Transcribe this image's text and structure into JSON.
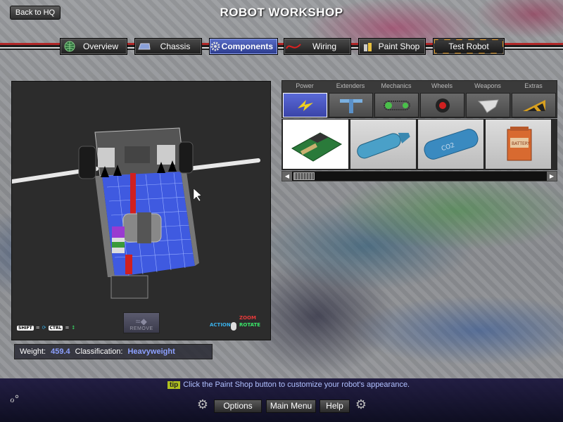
{
  "header": {
    "title": "ROBOT WORKSHOP",
    "back_label": "Back to HQ"
  },
  "tabs": [
    {
      "label": "Overview",
      "icon": "globe-icon"
    },
    {
      "label": "Chassis",
      "icon": "chassis-icon"
    },
    {
      "label": "Components",
      "icon": "gear-icon",
      "active": true
    },
    {
      "label": "Wiring",
      "icon": "wire-icon"
    },
    {
      "label": "Paint Shop",
      "icon": "paint-icon"
    },
    {
      "label": "Test Robot",
      "icon": "none"
    }
  ],
  "viewport": {
    "remove_label": "REMOVE",
    "hint_shift": "SHIFT",
    "hint_ctrl": "CTRL",
    "hint_action": "ACTION",
    "hint_zoom": "ZOOM",
    "hint_rotate": "ROTATE"
  },
  "stats": {
    "weight_label": "Weight:",
    "weight_value": "459.4",
    "class_label": "Classification:",
    "class_value": "Heavyweight"
  },
  "categories": [
    {
      "label": "Power",
      "icon": "lightning-icon",
      "active": true
    },
    {
      "label": "Extenders",
      "icon": "extender-icon"
    },
    {
      "label": "Mechanics",
      "icon": "chain-icon"
    },
    {
      "label": "Wheels",
      "icon": "wheel-icon"
    },
    {
      "label": "Weapons",
      "icon": "blade-icon"
    },
    {
      "label": "Extras",
      "icon": "wedge-icon"
    }
  ],
  "parts": [
    {
      "name": "circuit-board",
      "selected": true
    },
    {
      "name": "blue-tank"
    },
    {
      "name": "co2-tank",
      "label": "CO2"
    },
    {
      "name": "orange-battery",
      "label": "BATTERY"
    }
  ],
  "footer": {
    "tip_badge": "tip",
    "tip_text": "Click the Paint Shop button to customize your robot's appearance.",
    "options_label": "Options",
    "main_menu_label": "Main Menu",
    "help_label": "Help"
  },
  "colors": {
    "accent": "#5a6ed8",
    "value_text": "#8ca0ff",
    "tip_badge": "#b0c020",
    "tip_text": "#b0c0ff"
  }
}
